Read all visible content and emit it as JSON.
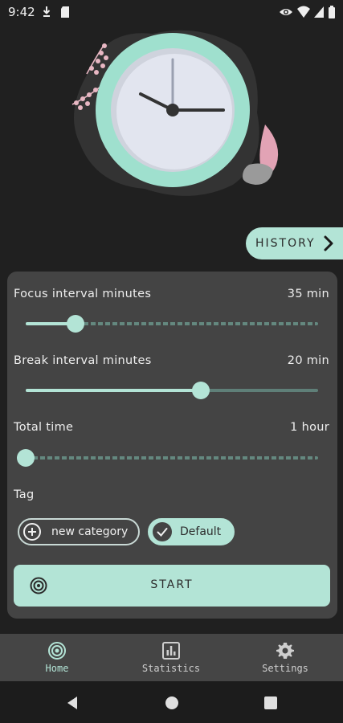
{
  "status_bar": {
    "time": "9:42"
  },
  "history_button": {
    "label": "HISTORY"
  },
  "settings": {
    "focus": {
      "label": "Focus interval minutes",
      "value": "35 min",
      "level": 0.17
    },
    "break": {
      "label": "Break interval minutes",
      "value": "20 min",
      "level": 0.6
    },
    "total": {
      "label": "Total time",
      "value": "1 hour",
      "level": 0.0
    }
  },
  "tag": {
    "label": "Tag",
    "chips": [
      {
        "label": "new category",
        "icon": "plus-circle-icon",
        "selected": false
      },
      {
        "label": "Default",
        "icon": "check-icon",
        "selected": true
      }
    ]
  },
  "start_button": {
    "label": "START",
    "icon": "target-icon"
  },
  "bottom_nav": {
    "items": [
      {
        "label": "Home",
        "icon": "target-icon",
        "active": true
      },
      {
        "label": "Statistics",
        "icon": "chart-icon",
        "active": false
      },
      {
        "label": "Settings",
        "icon": "gear-icon",
        "active": false
      }
    ]
  },
  "colors": {
    "accent": "#b3e4d6",
    "panel": "#444444",
    "background": "#202020",
    "nav": "#454545"
  }
}
